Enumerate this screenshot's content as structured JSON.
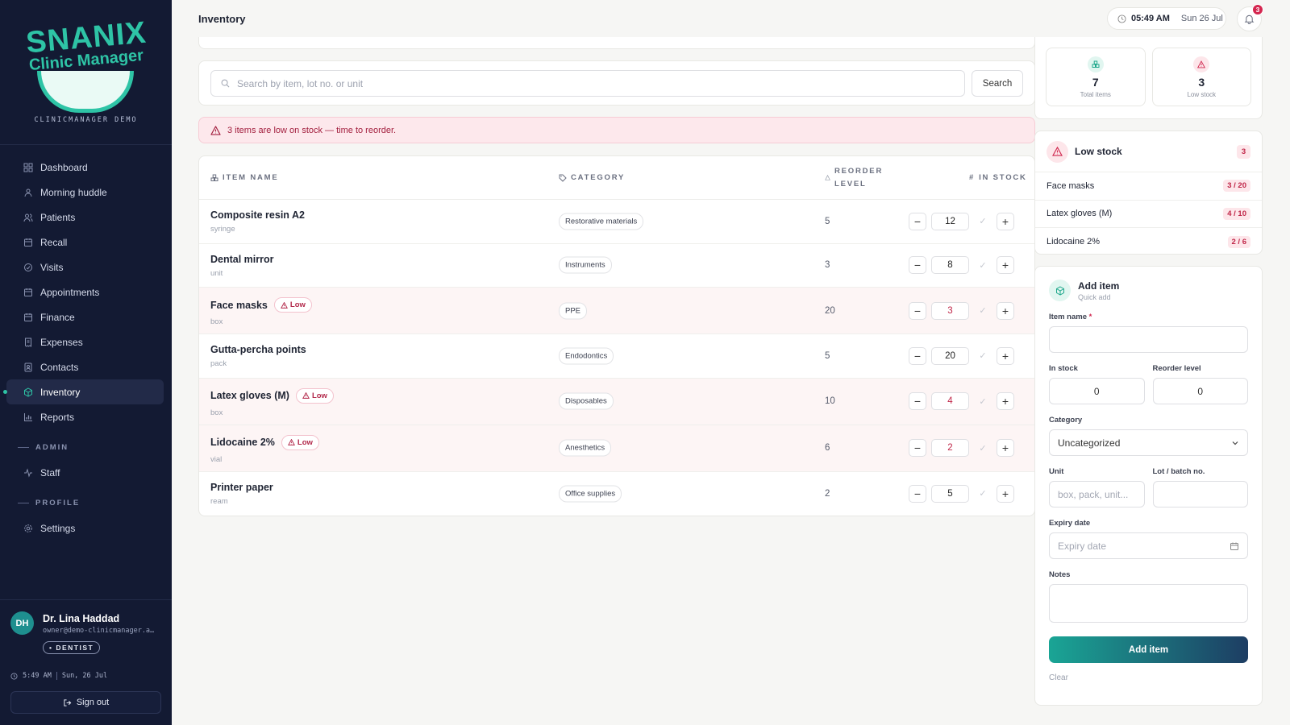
{
  "brand": {
    "name": "SNANIX",
    "subtitle": "Clinic Manager",
    "caption": "CLINICMANAGER DEMO"
  },
  "sidebar": {
    "items": [
      {
        "label": "Dashboard",
        "icon": "dashboard-icon"
      },
      {
        "label": "Morning huddle",
        "icon": "huddle-icon"
      },
      {
        "label": "Patients",
        "icon": "patients-icon"
      },
      {
        "label": "Recall",
        "icon": "recall-icon"
      },
      {
        "label": "Visits",
        "icon": "visits-icon"
      },
      {
        "label": "Appointments",
        "icon": "calendar-icon"
      },
      {
        "label": "Finance",
        "icon": "finance-icon"
      },
      {
        "label": "Expenses",
        "icon": "receipt-icon"
      },
      {
        "label": "Contacts",
        "icon": "contacts-icon"
      },
      {
        "label": "Inventory",
        "icon": "inventory-icon",
        "active": true
      },
      {
        "label": "Reports",
        "icon": "reports-icon"
      }
    ],
    "admin_section": "ADMIN",
    "admin_items": [
      {
        "label": "Staff",
        "icon": "activity-icon"
      }
    ],
    "profile_section": "PROFILE",
    "profile_items": [
      {
        "label": "Settings",
        "icon": "gear-icon"
      }
    ]
  },
  "user": {
    "initials": "DH",
    "name": "Dr. Lina Haddad",
    "email": "owner@demo-clinicmanager.a…",
    "role": "DENTIST",
    "time": "5:49 AM",
    "date": "Sun, 26 Jul",
    "signout_label": "Sign out"
  },
  "header": {
    "title": "Inventory",
    "time": "05:49 AM",
    "date": "Sun 26 Jul",
    "notifications": "3"
  },
  "search": {
    "placeholder": "Search by item, lot no. or unit",
    "button": "Search"
  },
  "alert": {
    "text": "3 items are low on stock — time to reorder."
  },
  "table": {
    "headers": {
      "item": "ITEM NAME",
      "category": "CATEGORY",
      "reorder_line1": "REORDER",
      "reorder_line2": "LEVEL",
      "stock": "IN STOCK"
    },
    "low_label": "Low",
    "rows": [
      {
        "name": "Composite resin A2",
        "unit": "syringe",
        "category": "Restorative materials",
        "reorder": "5",
        "stock": "12",
        "low": false
      },
      {
        "name": "Dental mirror",
        "unit": "unit",
        "category": "Instruments",
        "reorder": "3",
        "stock": "8",
        "low": false
      },
      {
        "name": "Face masks",
        "unit": "box",
        "category": "PPE",
        "reorder": "20",
        "stock": "3",
        "low": true
      },
      {
        "name": "Gutta-percha points",
        "unit": "pack",
        "category": "Endodontics",
        "reorder": "5",
        "stock": "20",
        "low": false
      },
      {
        "name": "Latex gloves (M)",
        "unit": "box",
        "category": "Disposables",
        "reorder": "10",
        "stock": "4",
        "low": true
      },
      {
        "name": "Lidocaine 2%",
        "unit": "vial",
        "category": "Anesthetics",
        "reorder": "6",
        "stock": "2",
        "low": true
      },
      {
        "name": "Printer paper",
        "unit": "ream",
        "category": "Office supplies",
        "reorder": "2",
        "stock": "5",
        "low": false
      }
    ]
  },
  "stats": {
    "total_value": "7",
    "total_label": "Total items",
    "low_value": "3",
    "low_label": "Low stock"
  },
  "low_stock": {
    "title": "Low stock",
    "count": "3",
    "items": [
      {
        "name": "Face masks",
        "ratio": "3 / 20"
      },
      {
        "name": "Latex gloves (M)",
        "ratio": "4 / 10"
      },
      {
        "name": "Lidocaine 2%",
        "ratio": "2 / 6"
      }
    ]
  },
  "add_item": {
    "title": "Add item",
    "subtitle": "Quick add",
    "item_name_label": "Item name",
    "required_mark": "*",
    "in_stock_label": "In stock",
    "in_stock_value": "0",
    "reorder_label": "Reorder level",
    "reorder_value": "0",
    "category_label": "Category",
    "category_value": "Uncategorized",
    "unit_label": "Unit",
    "unit_placeholder": "box, pack, unit...",
    "lot_label": "Lot / batch no.",
    "expiry_label": "Expiry date",
    "expiry_placeholder": "Expiry date",
    "notes_label": "Notes",
    "submit_label": "Add item",
    "clear_label": "Clear"
  },
  "colors": {
    "sidebar_bg": "#131a33",
    "accent": "#2ec4a6",
    "danger": "#c02648"
  }
}
